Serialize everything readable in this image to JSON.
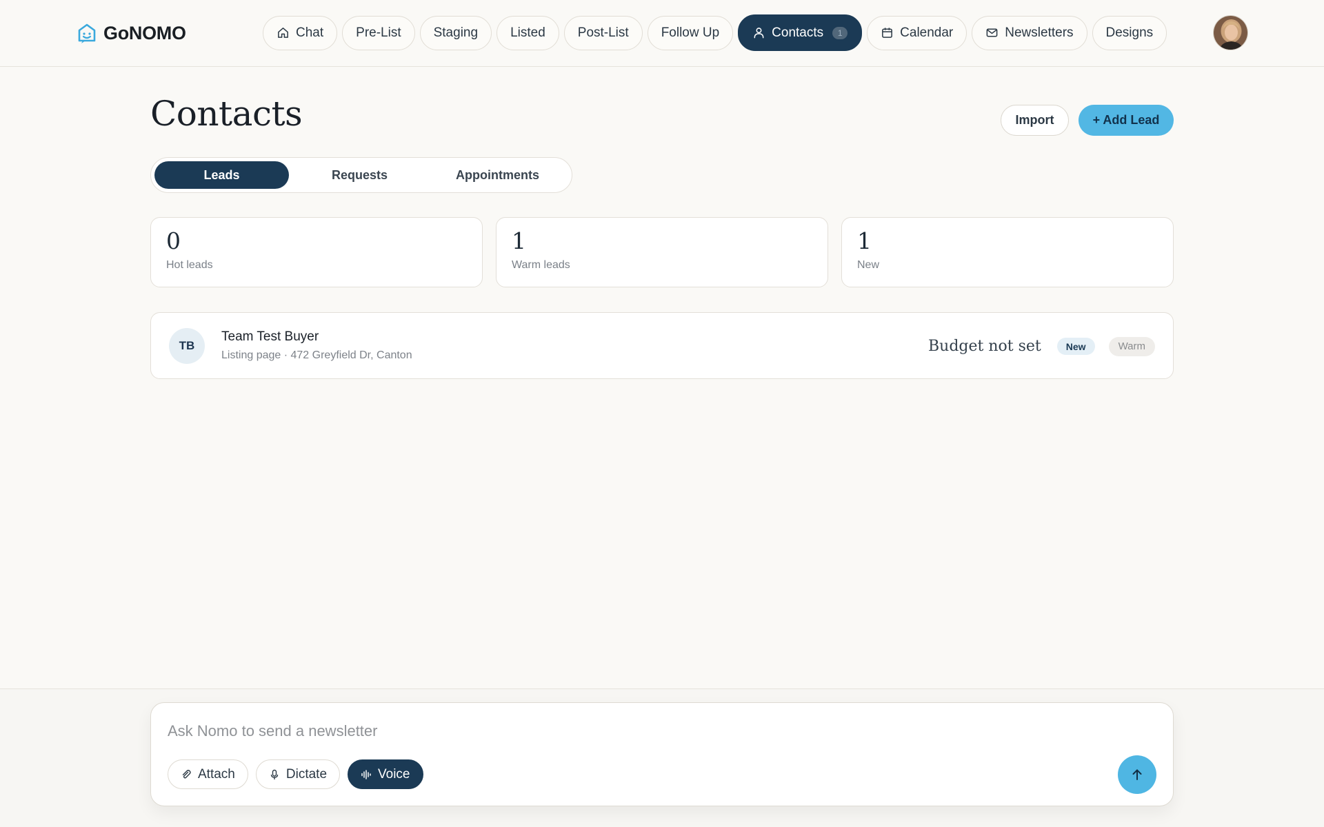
{
  "brand": {
    "name": "GoNOMO",
    "logo_icon": "house-face-icon"
  },
  "nav": {
    "items": [
      {
        "label": "Chat",
        "icon": "home-icon"
      },
      {
        "label": "Pre-List"
      },
      {
        "label": "Staging"
      },
      {
        "label": "Listed"
      },
      {
        "label": "Post-List"
      },
      {
        "label": "Follow Up"
      },
      {
        "label": "Contacts",
        "icon": "person-icon",
        "badge": "1",
        "active": true
      },
      {
        "label": "Calendar",
        "icon": "calendar-icon"
      },
      {
        "label": "Newsletters",
        "icon": "mail-icon"
      },
      {
        "label": "Designs"
      }
    ],
    "active_color": "#1b3a55"
  },
  "user": {
    "avatar_icon": "user-avatar-photo"
  },
  "page": {
    "title": "Contacts",
    "import_label": "Import",
    "add_lead_label": "+ Add Lead",
    "accent_color": "#52b7e4"
  },
  "tabs": [
    {
      "label": "Leads",
      "active": true
    },
    {
      "label": "Requests"
    },
    {
      "label": "Appointments"
    }
  ],
  "stats": [
    {
      "value": "0",
      "label": "Hot leads"
    },
    {
      "value": "1",
      "label": "Warm leads"
    },
    {
      "value": "1",
      "label": "New"
    }
  ],
  "leads": [
    {
      "initials": "TB",
      "name": "Team Test Buyer",
      "source": "Listing page · 472 Greyfield Dr, Canton",
      "budget": "Budget not set",
      "badge_new": "New",
      "badge_temp": "Warm"
    }
  ],
  "composer": {
    "placeholder": "Ask Nomo to send a newsletter",
    "attach_label": "Attach",
    "dictate_label": "Dictate",
    "voice_label": "Voice",
    "send_icon": "arrow-up-icon"
  }
}
